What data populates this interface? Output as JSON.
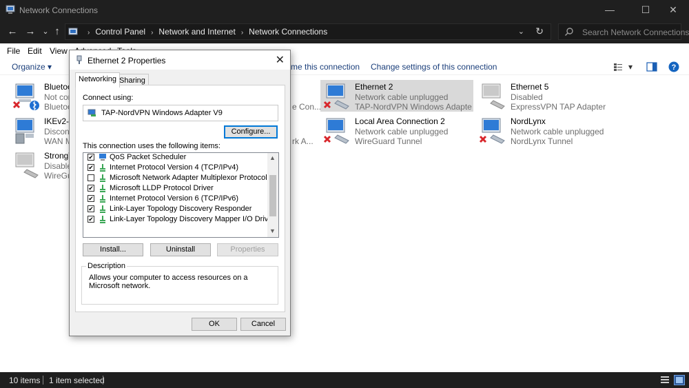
{
  "window": {
    "title": "Network Connections",
    "minimize": "—",
    "maximize": "☐",
    "close": "✕"
  },
  "nav": {
    "back": "←",
    "forward": "→",
    "recent": "⌄",
    "up": "↑"
  },
  "address": {
    "crumbs": [
      "Control Panel",
      "Network and Internet",
      "Network Connections"
    ],
    "dropdown": "⌄",
    "refresh": "↻"
  },
  "search": {
    "placeholder": "Search Network Connections"
  },
  "menu": [
    "File",
    "Edit",
    "View",
    "Advanced",
    "Tools"
  ],
  "commands": {
    "organize": "Organize ▾",
    "rename": "me this connection",
    "change": "Change settings of this connection",
    "view_dd": "▾"
  },
  "connections": [
    {
      "name": "Bluetoo",
      "status": "Not cor",
      "device": "Bluetoo",
      "state": "bluetooth"
    },
    {
      "name": "IKEv2-S",
      "status": "Disconn",
      "device": "WAN M",
      "state": "disconnected"
    },
    {
      "name": "StrongV",
      "status": "Disable",
      "device": "WireGu",
      "state": "disabled"
    },
    {
      "name": "Ethernet 2",
      "status": "Network cable unplugged",
      "device": "TAP-NordVPN Windows Adapter ...",
      "state": "unplugged"
    },
    {
      "name": "Local Area Connection 2",
      "status": "Network cable unplugged",
      "device": "WireGuard Tunnel",
      "state": "unplugged"
    },
    {
      "name": "Ethernet 5",
      "status": "Disabled",
      "device": "ExpressVPN TAP Adapter",
      "state": "disabled"
    },
    {
      "name": "NordLynx",
      "status": "Network cable unplugged",
      "device": "NordLynx Tunnel",
      "state": "unplugged"
    }
  ],
  "partial_labels": {
    "col2_row1": "e Con...",
    "col2_row2": "rk A..."
  },
  "status_bar": {
    "count": "10 items",
    "selected": "1 item selected"
  },
  "dialog": {
    "title": "Ethernet 2 Properties",
    "close": "✕",
    "tabs": [
      "Networking",
      "Sharing"
    ],
    "connect_using_label": "Connect using:",
    "adapter": "TAP-NordVPN Windows Adapter V9",
    "configure": "Configure...",
    "items_label": "This connection uses the following items:",
    "items": [
      {
        "label": "QoS Packet Scheduler",
        "checked": "✔"
      },
      {
        "label": "Internet Protocol Version 4 (TCP/IPv4)",
        "checked": "✔"
      },
      {
        "label": "Microsoft Network Adapter Multiplexor Protocol",
        "checked": ""
      },
      {
        "label": "Microsoft LLDP Protocol Driver",
        "checked": "✔"
      },
      {
        "label": "Internet Protocol Version 6 (TCP/IPv6)",
        "checked": "✔"
      },
      {
        "label": "Link-Layer Topology Discovery Responder",
        "checked": "✔"
      },
      {
        "label": "Link-Layer Topology Discovery Mapper I/O Driver",
        "checked": "✔"
      }
    ],
    "install": "Install...",
    "uninstall": "Uninstall",
    "properties": "Properties",
    "description_label": "Description",
    "description": "Allows your computer to access resources on a Microsoft network.",
    "ok": "OK",
    "cancel": "Cancel"
  },
  "colors": {
    "dark_chrome": "#1f1f1f",
    "link_blue": "#1a3e7a",
    "selection": "#d9d9d9",
    "error_red": "#d8262b"
  }
}
